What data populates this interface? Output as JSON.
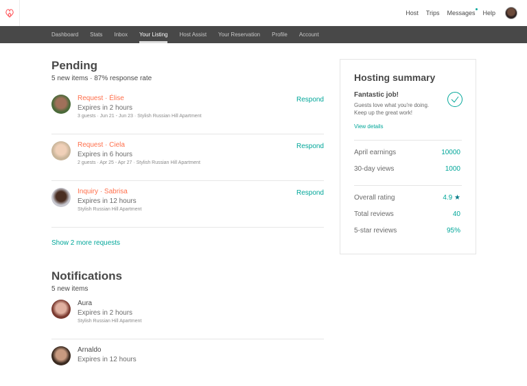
{
  "header": {
    "links": [
      "Host",
      "Trips",
      "Messages",
      "Help"
    ]
  },
  "nav": {
    "items": [
      "Dashboard",
      "Stats",
      "Inbox",
      "Your Listing",
      "Host Assist",
      "Your Reservation",
      "Profile",
      "Account"
    ],
    "active": "Your Listing"
  },
  "pending": {
    "title": "Pending",
    "subtitle": "5 new items · 87% response rate",
    "items": [
      {
        "title": "Request · Élise",
        "expires": "Expires in 2 hours",
        "detail": "3 guests · Jun 21 - Jun 23 · Stylish Russian Hill Apartment",
        "action": "Respond"
      },
      {
        "title": "Request · Ciela",
        "expires": "Expires in 6 hours",
        "detail": "2 guests · Apr 25 - Apr 27 · Stylish Russian Hill Apartment",
        "action": "Respond"
      },
      {
        "title": "Inquiry · Sabrisa",
        "expires": "Expires in 12 hours",
        "detail": "Stylish Russian Hill Apartment",
        "action": "Respond"
      }
    ],
    "more": "Show 2 more requests"
  },
  "notifications": {
    "title": "Notifications",
    "subtitle": "5 new items",
    "items": [
      {
        "name": "Aura",
        "expires": "Expires in 2 hours",
        "detail": "Stylish Russian Hill Apartment"
      },
      {
        "name": "Arnaldo",
        "expires": "Expires in 12 hours"
      }
    ]
  },
  "summary": {
    "title": "Hosting summary",
    "headline": "Fantastic job!",
    "line1": "Guests love what you're doing.",
    "line2": "Keep up the great work!",
    "link": "View details",
    "stats": [
      {
        "label": "April earnings",
        "value": "10000"
      },
      {
        "label": "30-day views",
        "value": "1000"
      },
      {
        "label": "Overall rating",
        "value": "4.9"
      },
      {
        "label": "Total reviews",
        "value": "40"
      },
      {
        "label": "5-star reviews",
        "value": "95%"
      }
    ]
  },
  "colors": {
    "accent": "#00a699",
    "brand": "#ff5a5f",
    "request": "#ff6e4a"
  }
}
